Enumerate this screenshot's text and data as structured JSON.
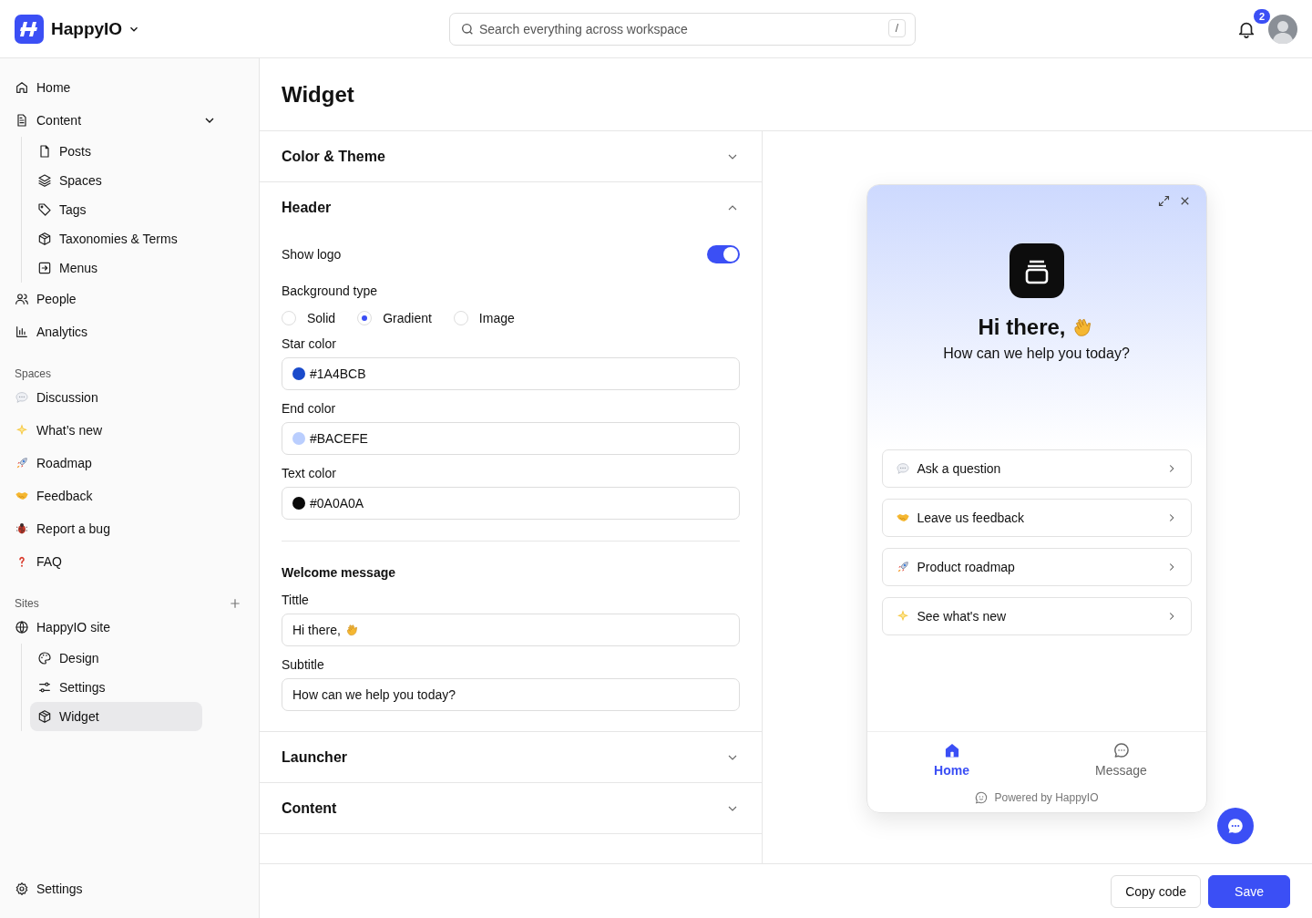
{
  "app": {
    "name": "HappyIO"
  },
  "search": {
    "placeholder": "Search everything across workspace",
    "shortcut": "/"
  },
  "notifications": {
    "count": "2"
  },
  "sidebar": {
    "nav": [
      {
        "label": "Home",
        "selected": false
      },
      {
        "label": "Content",
        "selected": false,
        "expanded": true,
        "children": [
          {
            "label": "Posts",
            "selected": false
          },
          {
            "label": "Spaces",
            "selected": false
          },
          {
            "label": "Tags",
            "selected": false
          },
          {
            "label": "Taxonomies & Terms",
            "selected": false
          },
          {
            "label": "Menus",
            "selected": false
          }
        ]
      },
      {
        "label": "People",
        "selected": false
      },
      {
        "label": "Analytics",
        "selected": false
      }
    ],
    "sections": [
      {
        "title": "Spaces",
        "addable": false,
        "items": [
          {
            "label": "Discussion",
            "selected": false
          },
          {
            "label": "What’s new",
            "selected": false
          },
          {
            "label": "Roadmap",
            "selected": false
          },
          {
            "label": "Feedback",
            "selected": false
          },
          {
            "label": "Report a bug",
            "selected": false
          },
          {
            "label": "FAQ",
            "selected": false
          }
        ]
      },
      {
        "title": "Sites",
        "addable": true,
        "items": [
          {
            "label": "HappyIO site",
            "selected": false,
            "children": [
              {
                "label": "Design",
                "selected": false
              },
              {
                "label": "Settings",
                "selected": false
              },
              {
                "label": "Widget",
                "selected": true
              }
            ]
          }
        ]
      }
    ],
    "bottom_item": {
      "label": "Settings",
      "selected": false
    }
  },
  "page": {
    "title": "Widget"
  },
  "form": {
    "sections": [
      {
        "title": "Color & Theme",
        "expanded": false
      },
      {
        "title": "Header",
        "expanded": true,
        "show_logo": {
          "label": "Show logo",
          "on": true
        },
        "background_type": {
          "label": "Background type",
          "options": [
            {
              "label": "Solid",
              "selected": false
            },
            {
              "label": "Gradient",
              "selected": true
            },
            {
              "label": "Image",
              "selected": false
            }
          ]
        },
        "color_fields": [
          {
            "label": "Star color",
            "value": "#1A4BCB",
            "color": "#1a4bcb"
          },
          {
            "label": "End color",
            "value": "#BACEFE",
            "color": "#bacefe"
          },
          {
            "label": "Text color",
            "value": "#0A0A0A",
            "color": "#0a0a0a"
          }
        ],
        "welcome": {
          "title": "Welcome message",
          "fields": [
            {
              "label": "Tittle",
              "value": "Hi there,",
              "wave": true
            },
            {
              "label": "Subtitle",
              "value": "How can we help you today?",
              "wave": false
            }
          ]
        }
      },
      {
        "title": "Launcher",
        "expanded": false
      },
      {
        "title": "Content",
        "expanded": false
      }
    ]
  },
  "preview": {
    "title": "Hi there,",
    "wave": true,
    "subtitle": "How can we help you today?",
    "links": [
      {
        "label": "Ask a question"
      },
      {
        "label": "Leave us feedback"
      },
      {
        "label": "Product roadmap"
      },
      {
        "label": "See what's new"
      }
    ],
    "tabs": [
      {
        "label": "Home",
        "selected": true
      },
      {
        "label": "Message",
        "selected": false
      }
    ],
    "powered_by": "Powered by HappyIO"
  },
  "actions": [
    {
      "label": "Copy code",
      "kind": "secondary"
    },
    {
      "label": "Save",
      "kind": "primary"
    }
  ]
}
